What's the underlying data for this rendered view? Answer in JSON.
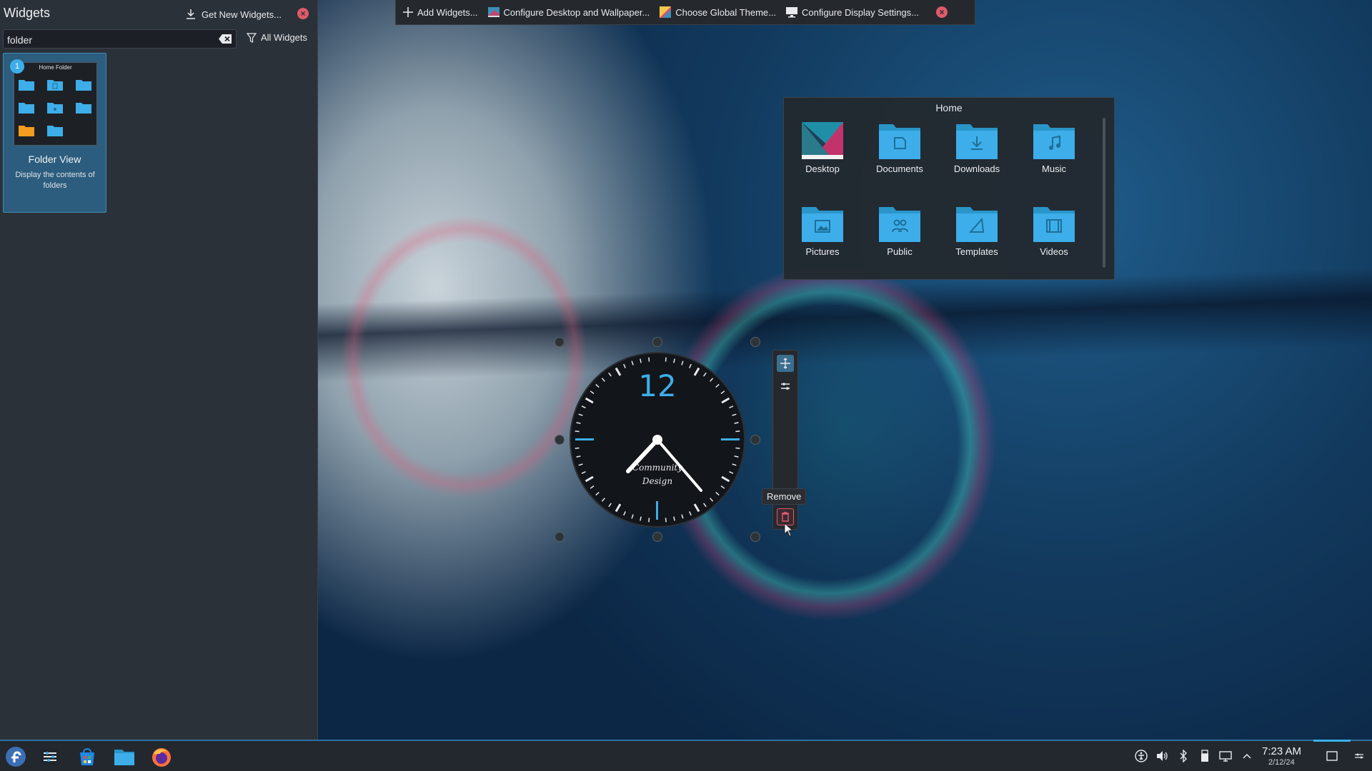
{
  "sidebar": {
    "title": "Widgets",
    "get_new_label": "Get New Widgets...",
    "search_value": "folder",
    "filter_label": "All Widgets",
    "card": {
      "preview_title": "Home Folder",
      "badge": "1",
      "name": "Folder View",
      "description": "Display the contents of folders"
    }
  },
  "toolbar": {
    "add_widgets": "Add Widgets...",
    "configure_desktop": "Configure Desktop and Wallpaper...",
    "global_theme": "Choose Global Theme...",
    "display_settings": "Configure Display Settings..."
  },
  "folder_view": {
    "title": "Home",
    "items": [
      {
        "label": "Desktop",
        "icon": "desktop-folder-icon"
      },
      {
        "label": "Documents",
        "icon": "documents-folder-icon"
      },
      {
        "label": "Downloads",
        "icon": "downloads-folder-icon"
      },
      {
        "label": "Music",
        "icon": "music-folder-icon"
      },
      {
        "label": "Pictures",
        "icon": "pictures-folder-icon"
      },
      {
        "label": "Public",
        "icon": "public-folder-icon"
      },
      {
        "label": "Templates",
        "icon": "templates-folder-icon"
      },
      {
        "label": "Videos",
        "icon": "videos-folder-icon"
      }
    ]
  },
  "clock": {
    "twelve": "12",
    "brand_line1": "Community",
    "brand_line2": "Design",
    "remove_tooltip": "Remove"
  },
  "taskbar": {
    "time": "7:23 AM",
    "date": "2/12/24"
  },
  "colors": {
    "accent": "#3daee9",
    "folder": "#3daee9",
    "close": "#e05a6a"
  }
}
